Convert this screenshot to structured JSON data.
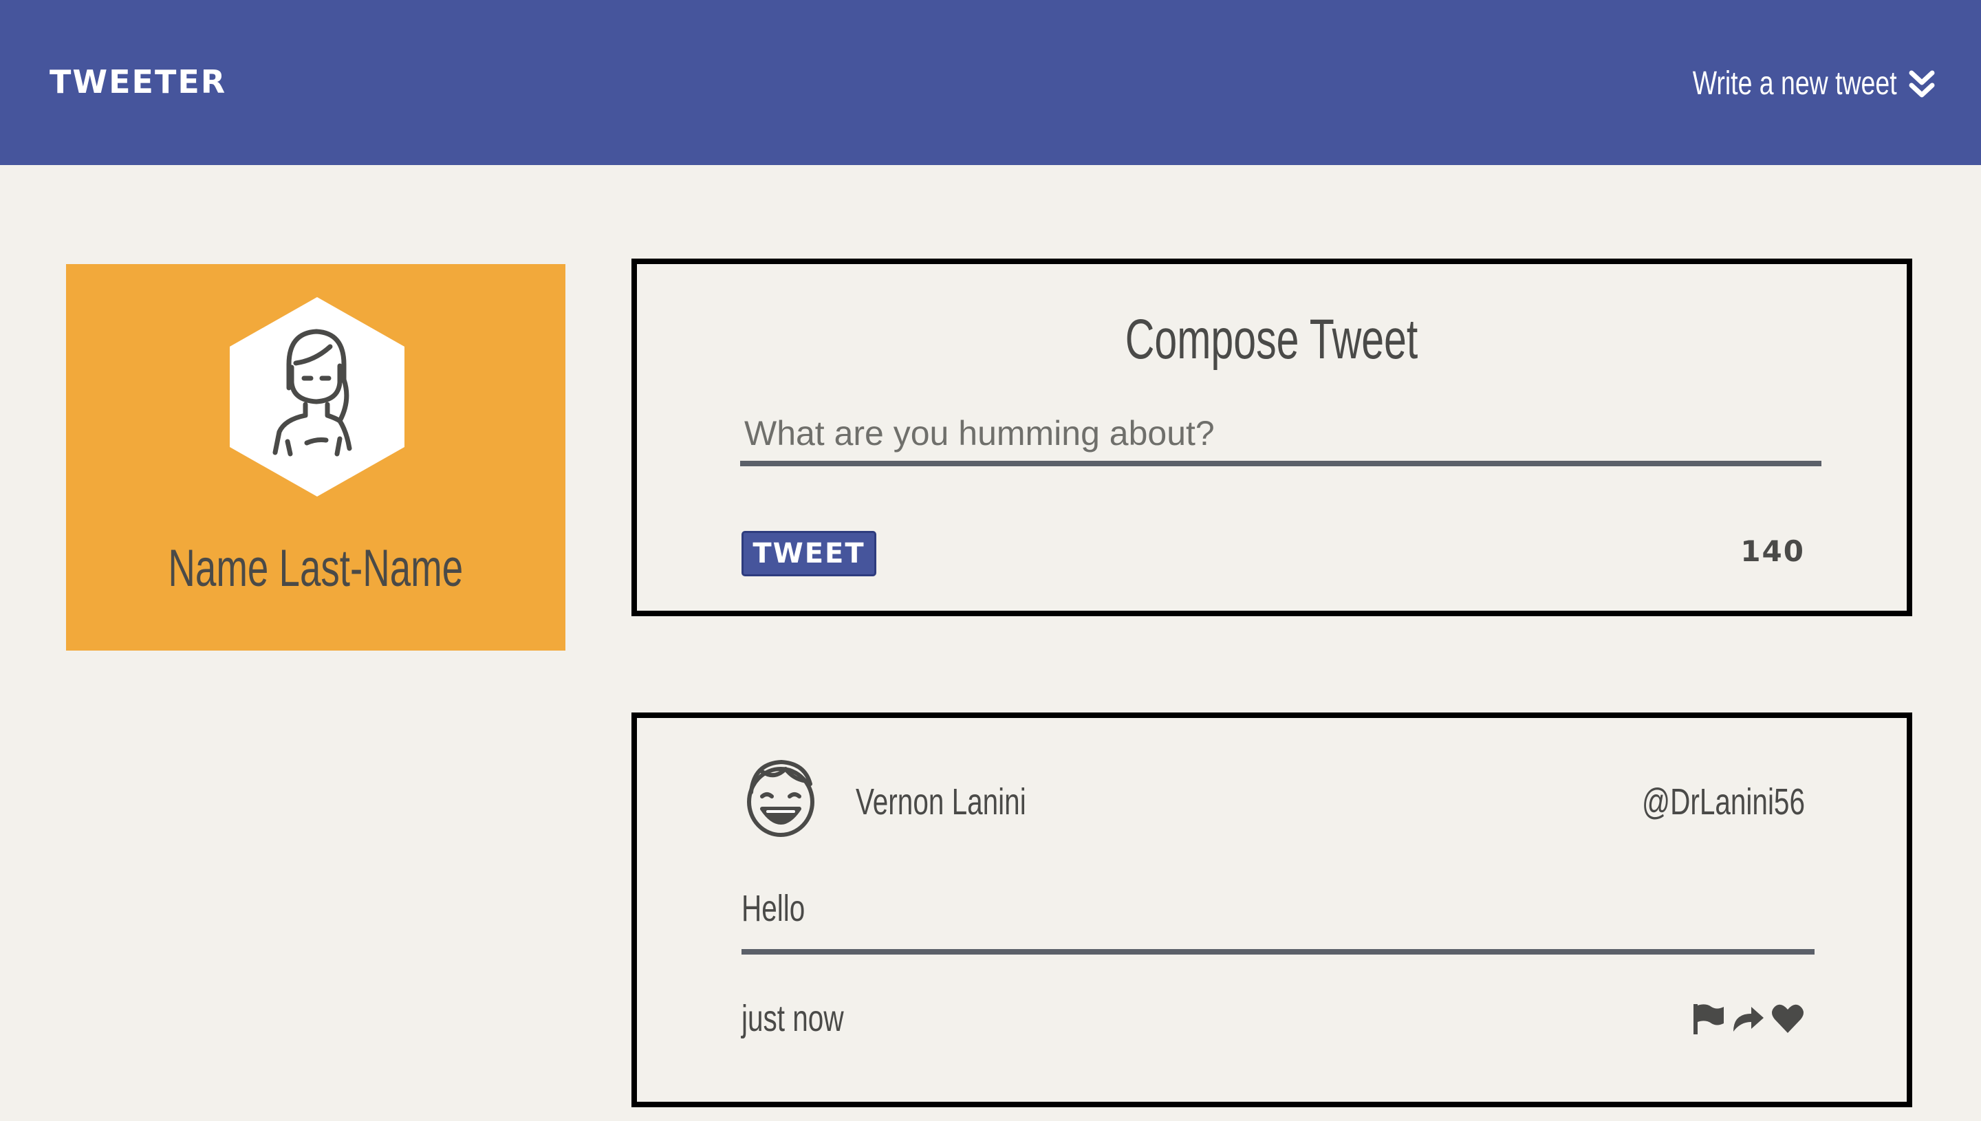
{
  "nav": {
    "brand": "TWEETER",
    "compose_toggle_label": "Write a new tweet",
    "compose_toggle_icon": "double-chevron-down-icon",
    "color": "#46559c"
  },
  "profile": {
    "name": "Name Last-Name",
    "avatar_icon": "woman-avatar-icon",
    "background_color": "#f2a93b"
  },
  "compose": {
    "title": "Compose Tweet",
    "placeholder": "What are you humming about?",
    "value": "",
    "submit_label": "TWEET",
    "char_counter": "140"
  },
  "tweets": [
    {
      "avatar_icon": "laughing-man-avatar-icon",
      "name": "Vernon Lanini",
      "handle": "@DrLanini56",
      "text": "Hello",
      "time": "just now",
      "actions": [
        "flag-icon",
        "retweet-icon",
        "heart-icon"
      ]
    }
  ]
}
